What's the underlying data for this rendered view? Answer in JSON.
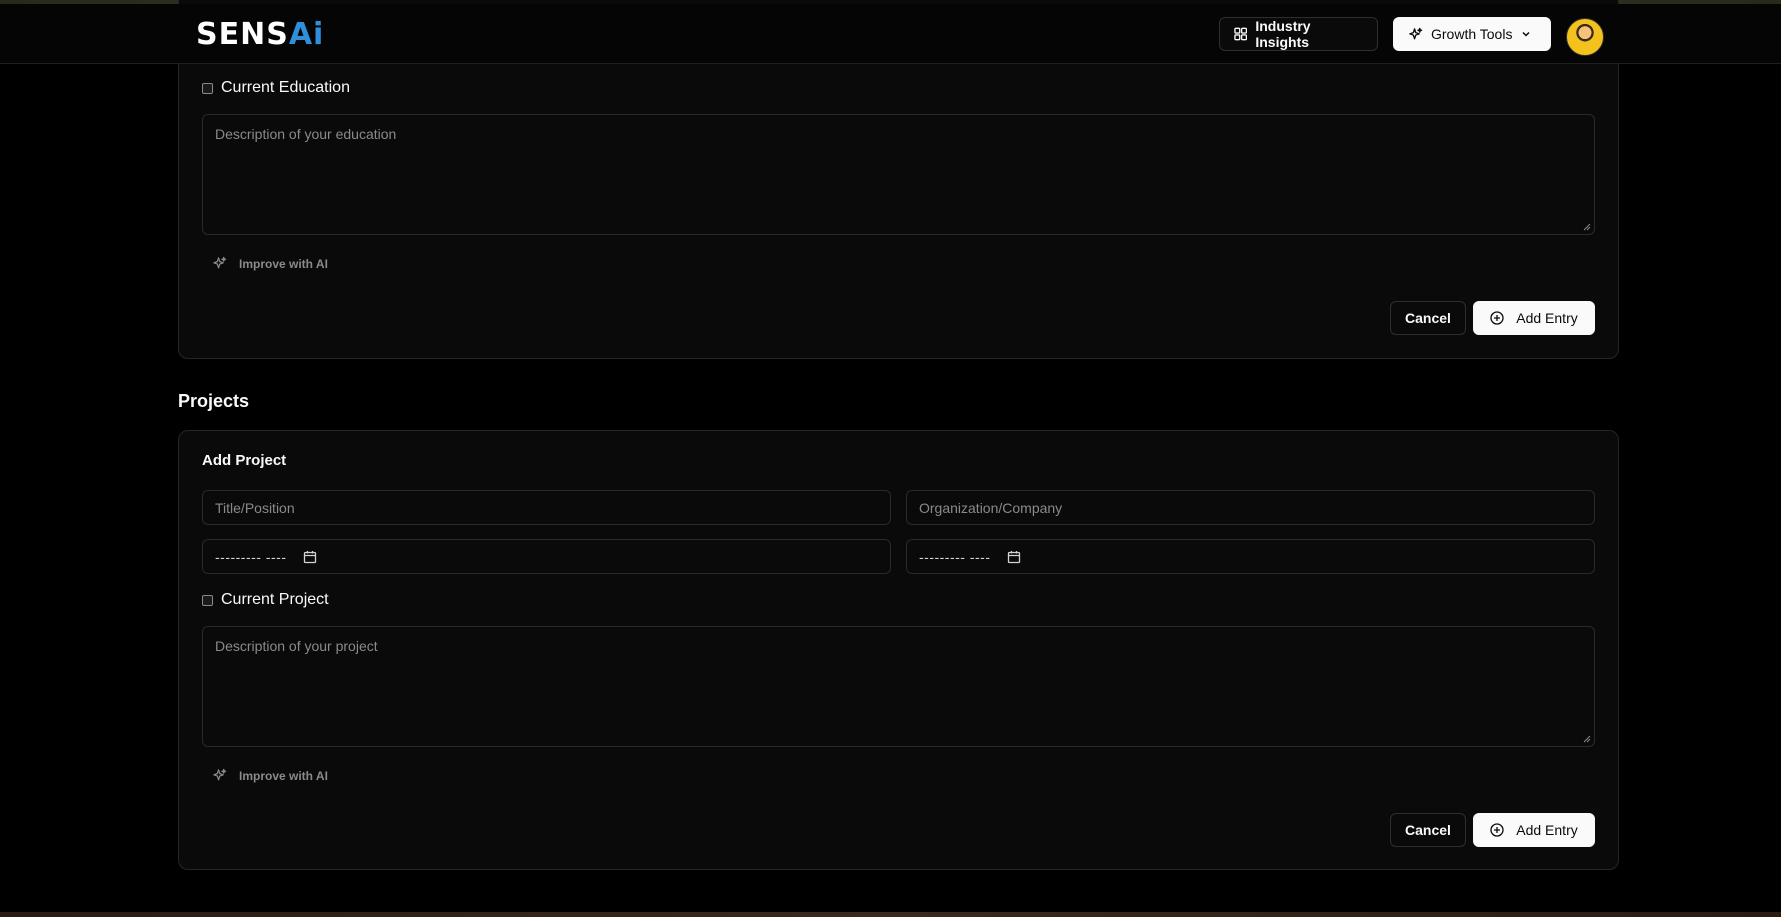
{
  "header": {
    "logo_part1": "SENS",
    "logo_part2": "Ai",
    "industry_insights_label": "Industry Insights",
    "growth_tools_label": "Growth Tools"
  },
  "education": {
    "current_checkbox_label": "Current Education",
    "description_placeholder": "Description of your education",
    "improve_ai_label": "Improve with AI",
    "cancel_label": "Cancel",
    "add_entry_label": "Add Entry"
  },
  "projects": {
    "section_title": "Projects",
    "card_title": "Add Project",
    "title_placeholder": "Title/Position",
    "organization_placeholder": "Organization/Company",
    "start_date_mask": "--------- ----",
    "end_date_mask": "--------- ----",
    "current_checkbox_label": "Current Project",
    "description_placeholder": "Description of your project",
    "improve_ai_label": "Improve with AI",
    "cancel_label": "Cancel",
    "add_entry_label": "Add Entry"
  },
  "colors": {
    "background": "#000000",
    "card": "#0a0a0a",
    "border": "#262626",
    "primary_button": "#fafafa",
    "logo_accent": "#2f8fd8"
  },
  "icons": {
    "insights": "layout-grid-icon",
    "growth": "sparkles-icon",
    "chevron": "chevron-down-icon",
    "add": "plus-circle-icon",
    "calendar": "calendar-icon"
  }
}
